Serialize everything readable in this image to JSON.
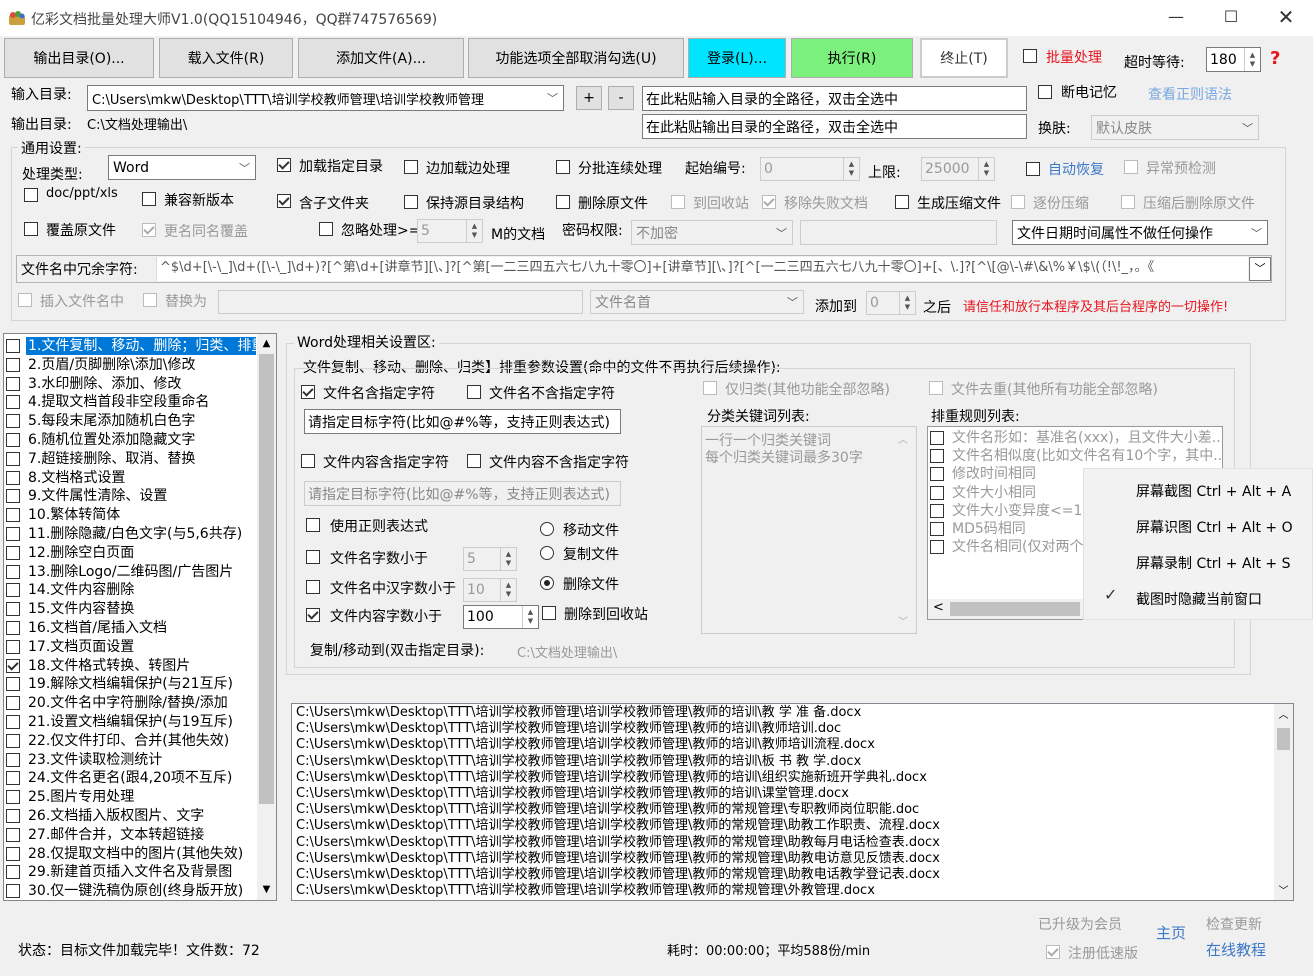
{
  "window": {
    "title": "亿彩文档批量处理大师V1.0(QQ15104946，QQ群747576569)",
    "min_icon": "minimize-icon",
    "max_icon": "maximize-icon",
    "close_icon": "close-icon"
  },
  "toolbar": {
    "output_dir": "输出目录(O)...",
    "load_file": "载入文件(R)",
    "add_file": "添加文件(A)...",
    "uncheck_all": "功能选项全部取消勾选(U)",
    "login": "登录(L)...",
    "execute": "执行(R)",
    "stop": "终止(T)",
    "batch_label": "批量处理",
    "timeout_label": "超时等待:",
    "timeout_value": "180",
    "help_icon": "?"
  },
  "colors": {
    "login_bg": "#00e5ff",
    "execute_bg": "#7cf07c",
    "red": "#e8141e",
    "link": "#3c78c8",
    "selected": "#0078d7"
  },
  "input": {
    "label": "输入目录:",
    "value": "C:\\Users\\mkw\\Desktop\\TTT\\培训学校教师管理\\培训学校教师管理",
    "plus": "+",
    "minus": "-",
    "paste_in": "在此粘贴输入目录的全路径，双击全选中",
    "resume": "断电记忆",
    "regex_link": "查看正则语法"
  },
  "output": {
    "label": "输出目录:",
    "value": "C:\\文档处理输出\\",
    "paste_out": "在此粘贴输出目录的全路径，双击全选中",
    "skin_label": "换肤:",
    "skin_value": "默认皮肤"
  },
  "general": {
    "title": "通用设置:",
    "type_label": "处理类型:",
    "type_value": "Word",
    "load_dir": "加载指定目录",
    "edge_load": "边加载边处理",
    "batch_cont": "分批连续处理",
    "start_label": "起始编号:",
    "start_value": "0",
    "limit_label": "上限:",
    "limit_value": "25000",
    "auto_restore": "自动恢复",
    "abnormal": "异常预检测",
    "doc_types": "doc/ppt/xls",
    "compat": "兼容新版本",
    "subfolder": "含子文件夹",
    "keep_struct": "保持源目录结构",
    "delete_src": "删除原文件",
    "to_recycle": "到回收站",
    "move_fail": "移除失败文档",
    "gen_zip": "生成压缩文件",
    "one_by_one": "逐份压缩",
    "del_after_zip": "压缩后删除原文件",
    "overwrite": "覆盖原文件",
    "rename_same": "更名同名覆盖",
    "ignore_label": "忽略处理>=",
    "ignore_value": "5",
    "ignore_unit": "M的文档",
    "pwd_label": "密码权限:",
    "pwd_value": "不加密",
    "date_attr": "文件日期时间属性不做任何操作",
    "redundant_label": "文件名中冗余字符:",
    "redundant_value": "^$\\d+[\\-\\_]\\d+([\\-\\_]\\d+)?[^第\\d+[讲章节][\\、]?[^第[一二三四五六七八九十零〇]+[讲章节][\\、]?[^[一二三四五六七八九十零〇]+[、\\.]?[^\\[@\\-\\#\\&\\%￥\\$\\(（!\\!_，。《",
    "insert_name": "插入文件名中",
    "replace_as": "替换为",
    "position_value": "文件名首",
    "add_to": "添加到",
    "add_value": "0",
    "after": "之后",
    "warning": "请信任和放行本程序及其后台程序的一切操作!"
  },
  "functions": [
    {
      "label": "1.文件复制、移动、删除；归类、排重",
      "checked": false,
      "selected": true
    },
    {
      "label": "2.页眉/页脚删除\\添加\\修改",
      "checked": false
    },
    {
      "label": "3.水印删除、添加、修改",
      "checked": false
    },
    {
      "label": "4.提取文档首段非空段重命名",
      "checked": false
    },
    {
      "label": "5.每段末尾添加随机白色字",
      "checked": false
    },
    {
      "label": "6.随机位置处添加隐藏文字",
      "checked": false
    },
    {
      "label": "7.超链接删除、取消、替换",
      "checked": false
    },
    {
      "label": "8.文档格式设置",
      "checked": false
    },
    {
      "label": "9.文件属性清除、设置",
      "checked": false
    },
    {
      "label": "10.繁体转简体",
      "checked": false
    },
    {
      "label": "11.删除隐藏/白色文字(与5,6共存)",
      "checked": false
    },
    {
      "label": "12.删除空白页面",
      "checked": false
    },
    {
      "label": "13.删除Logo/二维码图/广告图片",
      "checked": false
    },
    {
      "label": "14.文件内容删除",
      "checked": false
    },
    {
      "label": "15.文件内容替换",
      "checked": false
    },
    {
      "label": "16.文档首/尾插入文档",
      "checked": false
    },
    {
      "label": "17.文档页面设置",
      "checked": false
    },
    {
      "label": "18.文件格式转换、转图片",
      "checked": true
    },
    {
      "label": "19.解除文档编辑保护(与21互斥)",
      "checked": false
    },
    {
      "label": "20.文件名中字符删除/替换/添加",
      "checked": false
    },
    {
      "label": "21.设置文档编辑保护(与19互斥)",
      "checked": false
    },
    {
      "label": "22.仅文件打印、合并(其他失效)",
      "checked": false
    },
    {
      "label": "23.文件读取检测统计",
      "checked": false
    },
    {
      "label": "24.文件名更名(跟4,20项不互斥)",
      "checked": false
    },
    {
      "label": "25.图片专用处理",
      "checked": false
    },
    {
      "label": "26.文档插入版权图片、文字",
      "checked": false
    },
    {
      "label": "27.邮件合并，文本转超链接",
      "checked": false
    },
    {
      "label": "28.仅提取文档中的图片(其他失效)",
      "checked": false
    },
    {
      "label": "29.新建首页插入文件名及背景图",
      "checked": false
    },
    {
      "label": "30.仅一键洗稿伪原创(终身版开放)",
      "checked": false
    }
  ],
  "word": {
    "title": "Word处理相关设置区:",
    "subtitle": "文件复制、移动、删除、归类】排重参数设置(命中的文件不再执行后续操作):",
    "name_contains": "文件名含指定字符",
    "name_not_contains": "文件名不含指定字符",
    "target_ph1": "请指定目标字符(比如@#%等，支持正则表达式)",
    "content_contains": "文件内容含指定字符",
    "content_not_contains": "文件内容不含指定字符",
    "target_ph2": "请指定目标字符(比如@#%等，支持正则表达式)",
    "use_regex": "使用正则表达式",
    "name_len_lt": "文件名字数小于",
    "name_len_value": "5",
    "name_cn_lt": "文件名中汉字数小于",
    "name_cn_value": "10",
    "content_len_lt": "文件内容字数小于",
    "content_len_value": "100",
    "move": "移动文件",
    "copy": "复制文件",
    "delete": "删除文件",
    "del_recycle": "删除到回收站",
    "copy_to_label": "复制/移动到(双击指定目录):",
    "copy_to_value": "C:\\文档处理输出\\",
    "classify_only": "仅归类(其他功能全部忽略)",
    "dedup": "文件去重(其他所有功能全部忽略)",
    "keyword_title": "分类关键词列表:",
    "keyword_ph1": "一行一个归类关键词",
    "keyword_ph2": "每个归类关键词最多30字",
    "rule_title": "排重规则列表:",
    "rules": [
      "文件名形如：基准名(xxx)，且文件大小差...",
      "文件名相似度(比如文件名有10个字，其中...",
      "修改时间相同",
      "文件大小相同",
      "文件大小变异度<=1%",
      "MD5码相同",
      "文件名相同(仅对两个不同文..."
    ]
  },
  "context_menu": {
    "screenshot": "屏幕截图 Ctrl + Alt + A",
    "ocr": "屏幕识图 Ctrl + Alt + O",
    "record": "屏幕录制 Ctrl + Alt + S",
    "hide_window": "截图时隐藏当前窗口",
    "check_icon": "checkmark-icon"
  },
  "log": [
    "C:\\Users\\mkw\\Desktop\\TTT\\培训学校教师管理\\培训学校教师管理\\教师的培训\\教  学  准  备.docx",
    "C:\\Users\\mkw\\Desktop\\TTT\\培训学校教师管理\\培训学校教师管理\\教师的培训\\教师培训.doc",
    "C:\\Users\\mkw\\Desktop\\TTT\\培训学校教师管理\\培训学校教师管理\\教师的培训\\教师培训流程.docx",
    "C:\\Users\\mkw\\Desktop\\TTT\\培训学校教师管理\\培训学校教师管理\\教师的培训\\板  书  教  学.docx",
    "C:\\Users\\mkw\\Desktop\\TTT\\培训学校教师管理\\培训学校教师管理\\教师的培训\\组织实施新班开学典礼.docx",
    "C:\\Users\\mkw\\Desktop\\TTT\\培训学校教师管理\\培训学校教师管理\\教师的培训\\课堂管理.docx",
    "C:\\Users\\mkw\\Desktop\\TTT\\培训学校教师管理\\培训学校教师管理\\教师的常规管理\\专职教师岗位职能.doc",
    "C:\\Users\\mkw\\Desktop\\TTT\\培训学校教师管理\\培训学校教师管理\\教师的常规管理\\助教工作职责、流程.docx",
    "C:\\Users\\mkw\\Desktop\\TTT\\培训学校教师管理\\培训学校教师管理\\教师的常规管理\\助教每月电话检查表.docx",
    "C:\\Users\\mkw\\Desktop\\TTT\\培训学校教师管理\\培训学校教师管理\\教师的常规管理\\助教电访意见反馈表.docx",
    "C:\\Users\\mkw\\Desktop\\TTT\\培训学校教师管理\\培训学校教师管理\\教师的常规管理\\助教电话教学登记表.docx",
    "C:\\Users\\mkw\\Desktop\\TTT\\培训学校教师管理\\培训学校教师管理\\教师的常规管理\\外教管理.docx"
  ],
  "status": {
    "text": "状态：目标文件加载完毕！文件数：72",
    "elapsed": "耗时：00:00:00；平均588份/min",
    "member": "已升级为会员",
    "homepage": "主页",
    "check_update": "检查更新",
    "low_speed": "注册低速版",
    "online_tutorial": "在线教程"
  }
}
